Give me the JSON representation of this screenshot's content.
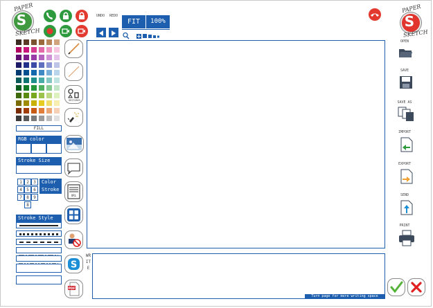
{
  "app": {
    "logo_top": "PAPER",
    "logo_bottom": "SKETCH",
    "logo_letter": "S"
  },
  "toolbar": {
    "undo": "UNDO",
    "redo": "REDO",
    "fit": "FIT",
    "zoom": "100%"
  },
  "palette": {
    "fill_label": "FILL",
    "colors": [
      [
        "#3d2b22",
        "#5a3a27",
        "#7a5230",
        "#9b6a3a",
        "#b8875a",
        "#d0a57e"
      ],
      [
        "#b1005f",
        "#c8147a",
        "#d53c8f",
        "#e36aa9",
        "#ee99c4",
        "#f6c7df"
      ],
      [
        "#5e0e6e",
        "#7c1c8a",
        "#9a3aa6",
        "#b564bf",
        "#cf92d6",
        "#e6c3ea"
      ],
      [
        "#1a1a66",
        "#23308a",
        "#3c4ba5",
        "#5f6ebd",
        "#8b96d3",
        "#bdc4e8"
      ],
      [
        "#003a70",
        "#00508f",
        "#1268ad",
        "#3f8ac4",
        "#78b0d9",
        "#b8d5ec"
      ],
      [
        "#0a5a5a",
        "#0f7272",
        "#1e8f8a",
        "#4aaca6",
        "#83c8c3",
        "#bfe3e0"
      ],
      [
        "#0a5a1e",
        "#137a2a",
        "#24963c",
        "#4fb060",
        "#86cb91",
        "#c3e6c8"
      ],
      [
        "#3f6a0c",
        "#5a8a12",
        "#78a820",
        "#9bc24a",
        "#bfd884",
        "#def0c0"
      ],
      [
        "#7a6a00",
        "#a08a00",
        "#c8b000",
        "#e6cc22",
        "#f0dd6a",
        "#f8eeb0"
      ],
      [
        "#7a2a00",
        "#a23c06",
        "#c85a14",
        "#e07e3a",
        "#eca676",
        "#f6d0b4"
      ],
      [
        "#3a3a3a",
        "#595959",
        "#7a7a7a",
        "#9b9b9b",
        "#bdbdbd",
        "#e0e0e0"
      ]
    ]
  },
  "rgb": {
    "label": "RGB color"
  },
  "stroke_size": {
    "label": "Stroke Size"
  },
  "numpad": {
    "keys": [
      "1",
      "2",
      "3",
      "4",
      "5",
      "6",
      "7",
      "8",
      "9",
      "8"
    ],
    "color_label": "Color",
    "stroke_label": "Stroke"
  },
  "stroke_style": {
    "label": "Stroke Style"
  },
  "tools": {
    "gestures_label": "GESTURES",
    "url_label": "URL"
  },
  "right_panel": {
    "open": "OPEN",
    "save": "SAVE",
    "save_as": "SAVE AS",
    "import": "IMPORT",
    "export": "EXPORT",
    "send": "SEND",
    "print": "PRINT"
  },
  "write": {
    "side_label": "WRITE",
    "hint": "Turn page for more writing space"
  },
  "colors": {
    "accent": "#1d5fae",
    "ok": "#56b33a",
    "cancel": "#e02020"
  }
}
